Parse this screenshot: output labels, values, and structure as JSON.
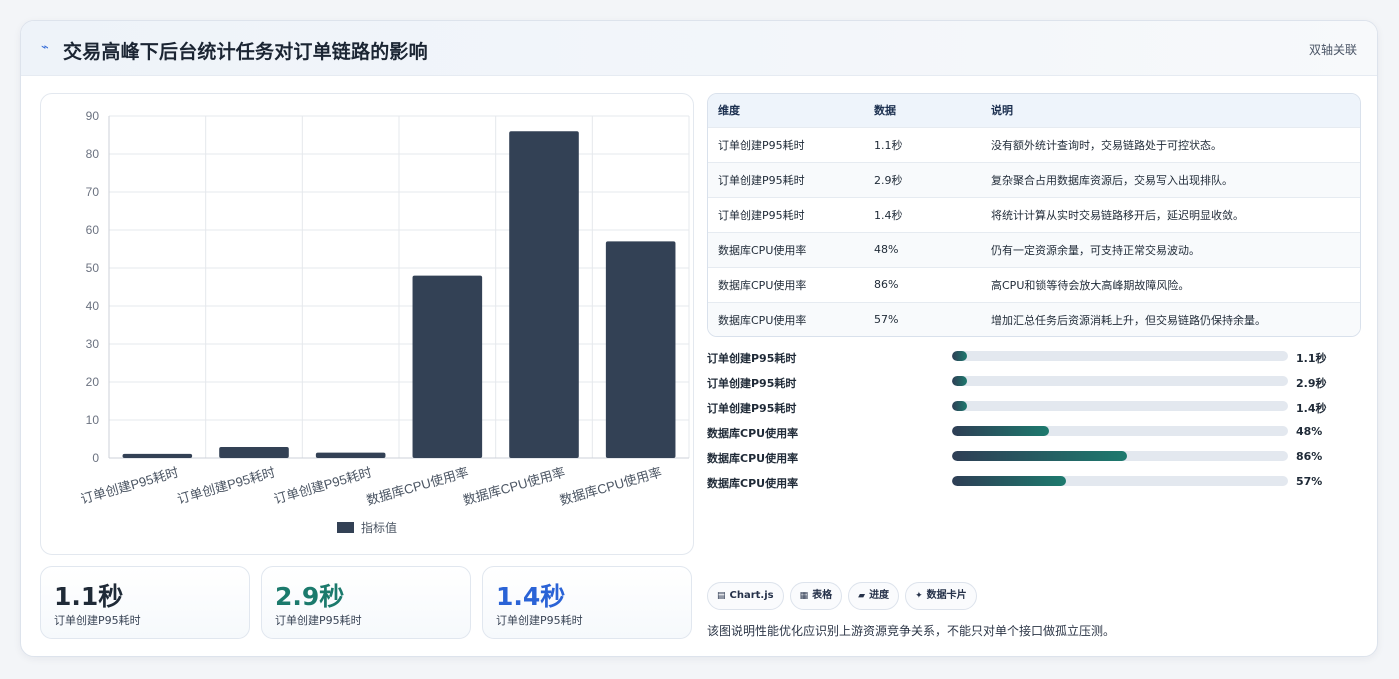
{
  "header": {
    "title": "交易高峰下后台统计任务对订单链路的影响",
    "tag": "双轴关联",
    "icon": "pulse-icon"
  },
  "chart_data": {
    "type": "bar",
    "categories": [
      "订单创建P95耗时",
      "订单创建P95耗时",
      "订单创建P95耗时",
      "数据库CPU使用率",
      "数据库CPU使用率",
      "数据库CPU使用率"
    ],
    "series": [
      {
        "name": "指标值",
        "values": [
          1.1,
          2.9,
          1.4,
          48,
          86,
          57
        ]
      }
    ],
    "yticks": [
      "0",
      "10",
      "20",
      "30",
      "40",
      "50",
      "60",
      "70",
      "80",
      "90"
    ],
    "ylim": [
      0,
      90
    ],
    "bar_color": "#334155",
    "grid": true,
    "legend": "bottom"
  },
  "stats": [
    {
      "value": "1.1秒",
      "label": "订单创建P95耗时",
      "color": "#1f2a37"
    },
    {
      "value": "2.9秒",
      "label": "订单创建P95耗时",
      "color": "#1b7a6c"
    },
    {
      "value": "1.4秒",
      "label": "订单创建P95耗时",
      "color": "#2a63d6"
    }
  ],
  "table": {
    "headers": [
      "维度",
      "数据",
      "说明"
    ],
    "rows": [
      [
        "订单创建P95耗时",
        "1.1秒",
        "没有额外统计查询时，交易链路处于可控状态。"
      ],
      [
        "订单创建P95耗时",
        "2.9秒",
        "复杂聚合占用数据库资源后，交易写入出现排队。"
      ],
      [
        "订单创建P95耗时",
        "1.4秒",
        "将统计计算从实时交易链路移开后，延迟明显收敛。"
      ],
      [
        "数据库CPU使用率",
        "48%",
        "仍有一定资源余量，可支持正常交易波动。"
      ],
      [
        "数据库CPU使用率",
        "86%",
        "高CPU和锁等待会放大高峰期故障风险。"
      ],
      [
        "数据库CPU使用率",
        "57%",
        "增加汇总任务后资源消耗上升，但交易链路仍保持余量。"
      ]
    ]
  },
  "progress": [
    {
      "label": "订单创建P95耗时",
      "value": "1.1秒",
      "fraction": 0.045
    },
    {
      "label": "订单创建P95耗时",
      "value": "2.9秒",
      "fraction": 0.045
    },
    {
      "label": "订单创建P95耗时",
      "value": "1.4秒",
      "fraction": 0.045
    },
    {
      "label": "数据库CPU使用率",
      "value": "48%",
      "fraction": 0.29
    },
    {
      "label": "数据库CPU使用率",
      "value": "86%",
      "fraction": 0.52
    },
    {
      "label": "数据库CPU使用率",
      "value": "57%",
      "fraction": 0.34
    }
  ],
  "chips": [
    {
      "icon": "chart-icon",
      "glyph": "▤",
      "label": "Chart.js"
    },
    {
      "icon": "table-icon",
      "glyph": "▦",
      "label": "表格"
    },
    {
      "icon": "progress-icon",
      "glyph": "▰",
      "label": "进度"
    },
    {
      "icon": "sparkle-icon",
      "glyph": "✦",
      "label": "数据卡片"
    }
  ],
  "note": "该图说明性能优化应识别上游资源竞争关系，不能只对单个接口做孤立压测。"
}
